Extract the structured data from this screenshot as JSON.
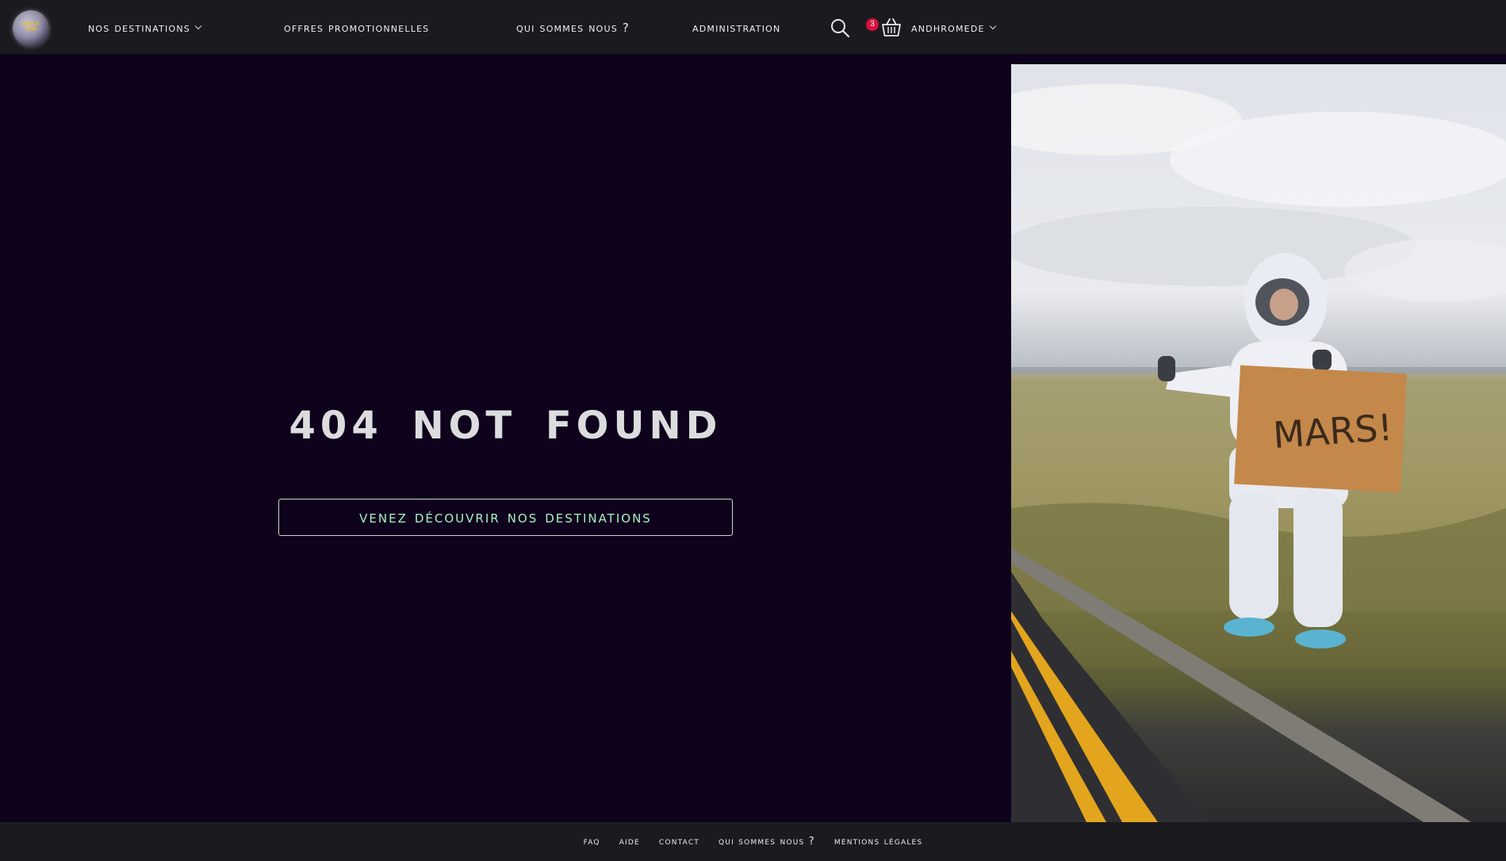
{
  "header": {
    "logo_text": "SPACE TRIP",
    "nav": {
      "destinations": "Nos destinations",
      "promos": "Offres promotionnelles",
      "about": "Qui sommes nous ?",
      "admin": "Administration",
      "user": "Andhromede"
    },
    "cart_count": "3",
    "icons": {
      "search": "search-icon",
      "cart": "basket-icon",
      "dropdown": "chevron-down-icon"
    }
  },
  "main": {
    "title": "404 NOT FOUND",
    "cta_label": "Venez découvrir nos destinations",
    "photo": {
      "sign_text": "MARS!"
    }
  },
  "footer": {
    "links": [
      "FAQ",
      "Aide",
      "Contact",
      "Qui sommes nous ?",
      "Mentions légales"
    ]
  },
  "colors": {
    "background": "#0f021c",
    "bar": "#1b1a1f",
    "cta_text": "#a9f0c4",
    "badge": "#d5123b"
  }
}
